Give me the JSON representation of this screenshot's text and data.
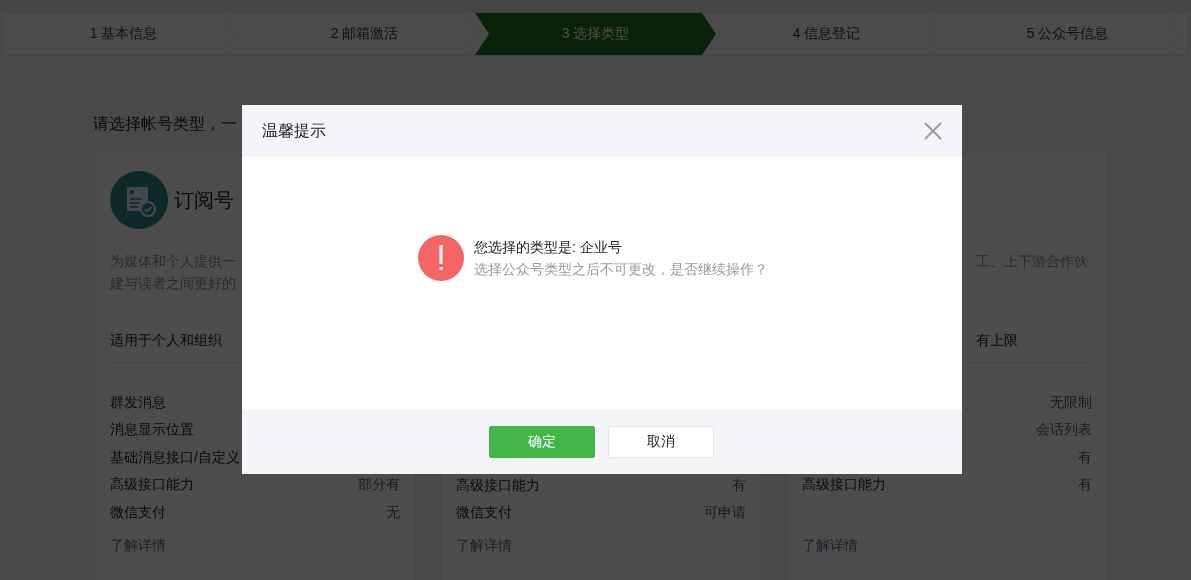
{
  "steps": [
    {
      "label": "1 基本信息",
      "selected": false
    },
    {
      "label": "2 邮箱激活",
      "selected": false
    },
    {
      "label": "3 选择类型",
      "selected": true
    },
    {
      "label": "4 信息登记",
      "selected": false
    },
    {
      "label": "5 公众号信息",
      "selected": false
    }
  ],
  "heading": "请选择帐号类型，一",
  "cards": [
    {
      "title": "订阅号",
      "description": [
        "为媒体和个人提供一",
        "建与读者之间更好的"
      ],
      "audience": "适用于个人和组织",
      "features": [
        {
          "label": "群发消息"
        },
        {
          "label": "消息显示位置"
        },
        {
          "label": "基础消息接口/自定义"
        },
        {
          "label": "高级接口能力",
          "value": "部分有"
        },
        {
          "label": "微信支付",
          "value": "无"
        }
      ],
      "link": "了解详情"
    },
    {
      "features": [
        {
          "label": "高级接口能力",
          "value": "有"
        },
        {
          "label": "微信支付",
          "value": "可申请"
        }
      ],
      "link": "了解详情"
    },
    {
      "description": [
        "工、上下游合作伙"
      ],
      "audience": "有上限",
      "features": [
        {
          "value": "无限制"
        },
        {
          "value": "会话列表"
        },
        {
          "value": "有"
        },
        {
          "label": "高级接口能力",
          "value": "有"
        }
      ],
      "link": "了解详情"
    }
  ],
  "dialog": {
    "title": "温馨提示",
    "message": "您选择的类型是: 企业号",
    "detail": "选择公众号类型之后不可更改，是否继续操作？",
    "buttons": [
      {
        "label": "确定",
        "kind": "primary"
      },
      {
        "label": "取消",
        "kind": "default"
      }
    ]
  }
}
